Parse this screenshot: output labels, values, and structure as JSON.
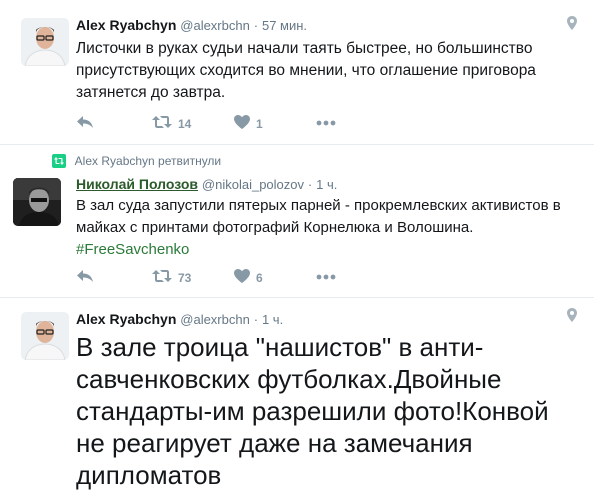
{
  "tweets": [
    {
      "author": "Alex Ryabchyn",
      "handle": "@alexrbchn",
      "time": "57 мин.",
      "text": "Листочки в руках судьи начали таять быстрее, но большинство присутствующих сходится во мнении, что оглашение приговора затянется до завтра.",
      "retweets": "14",
      "likes": "1"
    },
    {
      "retweeted_by": "Alex Ryabchyn ретвитнули",
      "author": "Николай Полозов",
      "handle": "@nikolai_polozov",
      "time": "1 ч.",
      "text": "В зал суда запустили пятерых парней - прокремлевских активистов в майках с принтами фотографий Корнелюка и Волошина.",
      "hashtag": "#FreeSavchenko",
      "retweets": "73",
      "likes": "6"
    },
    {
      "author": "Alex Ryabchyn",
      "handle": "@alexrbchn",
      "time": "1 ч.",
      "text": "В зале троица \"нашистов\" в анти-савченковских футболках.Двойные стандарты-им разрешили фото!Конвой не реагирует даже на замечания дипломатов"
    }
  ],
  "separator": "·",
  "colors": {
    "retweet_green": "#19cf86",
    "hashtag": "#2b7a3a",
    "meta": "#657786",
    "icon": "#8899a6"
  }
}
